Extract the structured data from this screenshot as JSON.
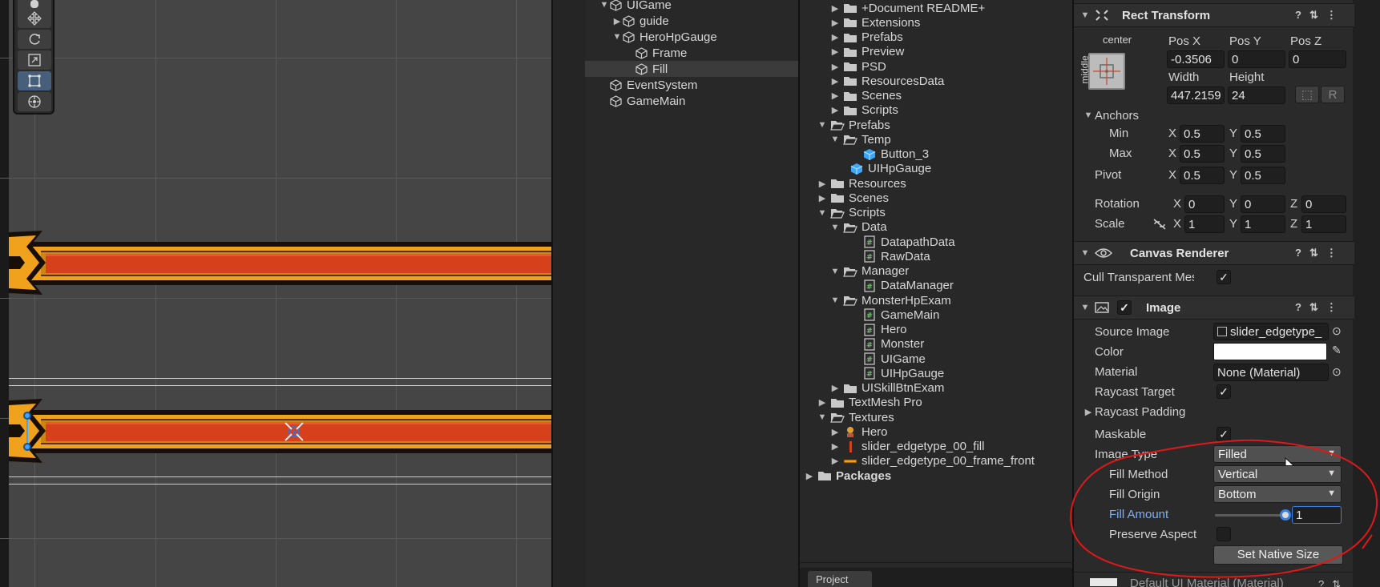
{
  "hierarchy": {
    "items": [
      {
        "label": "UIGame",
        "arrow": "down",
        "icon": "gameobject-icon"
      },
      {
        "label": "guide",
        "arrow": "right",
        "icon": "gameobject-icon"
      },
      {
        "label": "HeroHpGauge",
        "arrow": "down",
        "icon": "gameobject-icon"
      },
      {
        "label": "Frame",
        "arrow": "",
        "icon": "gameobject-icon"
      },
      {
        "label": "Fill",
        "arrow": "",
        "icon": "gameobject-icon",
        "selected": true
      },
      {
        "label": "EventSystem",
        "arrow": "",
        "icon": "gameobject-icon"
      },
      {
        "label": "GameMain",
        "arrow": "",
        "icon": "gameobject-icon"
      }
    ]
  },
  "project": {
    "items": [
      {
        "label": "+Document README+",
        "arrow": "right",
        "icon": "folder"
      },
      {
        "label": "Extensions",
        "arrow": "right",
        "icon": "folder"
      },
      {
        "label": "Prefabs",
        "arrow": "right",
        "icon": "folder"
      },
      {
        "label": "Preview",
        "arrow": "right",
        "icon": "folder"
      },
      {
        "label": "PSD",
        "arrow": "right",
        "icon": "folder"
      },
      {
        "label": "ResourcesData",
        "arrow": "right",
        "icon": "folder"
      },
      {
        "label": "Scenes",
        "arrow": "right",
        "icon": "folder"
      },
      {
        "label": "Scripts",
        "arrow": "right",
        "icon": "folder"
      },
      {
        "label": "Prefabs",
        "arrow": "down",
        "icon": "folder-open"
      },
      {
        "label": "Temp",
        "arrow": "down",
        "icon": "folder-open"
      },
      {
        "label": "Button_3",
        "arrow": "",
        "icon": "prefab"
      },
      {
        "label": "UIHpGauge",
        "arrow": "",
        "icon": "prefab"
      },
      {
        "label": "Resources",
        "arrow": "right",
        "icon": "folder"
      },
      {
        "label": "Scenes",
        "arrow": "right",
        "icon": "folder"
      },
      {
        "label": "Scripts",
        "arrow": "down",
        "icon": "folder-open"
      },
      {
        "label": "Data",
        "arrow": "down",
        "icon": "folder-open"
      },
      {
        "label": "DatapathData",
        "arrow": "",
        "icon": "script"
      },
      {
        "label": "RawData",
        "arrow": "",
        "icon": "script"
      },
      {
        "label": "Manager",
        "arrow": "down",
        "icon": "folder-open"
      },
      {
        "label": "DataManager",
        "arrow": "",
        "icon": "script"
      },
      {
        "label": "MonsterHpExam",
        "arrow": "down",
        "icon": "folder-open"
      },
      {
        "label": "GameMain",
        "arrow": "",
        "icon": "script"
      },
      {
        "label": "Hero",
        "arrow": "",
        "icon": "script"
      },
      {
        "label": "Monster",
        "arrow": "",
        "icon": "script"
      },
      {
        "label": "UIGame",
        "arrow": "",
        "icon": "script"
      },
      {
        "label": "UIHpGauge",
        "arrow": "",
        "icon": "script"
      },
      {
        "label": "UISkillBtnExam",
        "arrow": "right",
        "icon": "folder"
      },
      {
        "label": "TextMesh Pro",
        "arrow": "right",
        "icon": "folder"
      },
      {
        "label": "Textures",
        "arrow": "down",
        "icon": "folder-open"
      },
      {
        "label": "Hero",
        "arrow": "right",
        "icon": "sprite-hero"
      },
      {
        "label": "slider_edgetype_00_fill",
        "arrow": "right",
        "icon": "sprite-fill"
      },
      {
        "label": "slider_edgetype_00_frame_front",
        "arrow": "right",
        "icon": "sprite-frame"
      },
      {
        "label": "Packages",
        "arrow": "right",
        "icon": "folder",
        "bold": true
      }
    ],
    "tab_label": "Project"
  },
  "inspector": {
    "rect_transform": {
      "title": "Rect Transform",
      "anchor_h": "center",
      "anchor_v": "middle",
      "pos_x_label": "Pos X",
      "pos_y_label": "Pos Y",
      "pos_z_label": "Pos Z",
      "pos_x": "-0.3506",
      "pos_y": "0",
      "pos_z": "0",
      "width_label": "Width",
      "height_label": "Height",
      "width": "447.2159",
      "height": "24",
      "r_button": "R",
      "anchors_label": "Anchors",
      "min_label": "Min",
      "max_label": "Max",
      "pivot_label": "Pivot",
      "x_label": "X",
      "y_label": "Y",
      "z_label": "Z",
      "min_x": "0.5",
      "min_y": "0.5",
      "max_x": "0.5",
      "max_y": "0.5",
      "pivot_x": "0.5",
      "pivot_y": "0.5",
      "rotation_label": "Rotation",
      "rot_x": "0",
      "rot_y": "0",
      "rot_z": "0",
      "scale_label": "Scale",
      "scale_x": "1",
      "scale_y": "1",
      "scale_z": "1"
    },
    "canvas_renderer": {
      "title": "Canvas Renderer",
      "cull_label": "Cull Transparent Mes",
      "cull_checked": true
    },
    "image": {
      "title": "Image",
      "source_label": "Source Image",
      "source_value": "slider_edgetype_",
      "color_label": "Color",
      "color_value": "#ffffff",
      "material_label": "Material",
      "material_value": "None (Material)",
      "raycast_target_label": "Raycast Target",
      "raycast_padding_label": "Raycast Padding",
      "maskable_label": "Maskable",
      "image_type_label": "Image Type",
      "image_type_value": "Filled",
      "fill_method_label": "Fill Method",
      "fill_method_value": "Vertical",
      "fill_origin_label": "Fill Origin",
      "fill_origin_value": "Bottom",
      "fill_amount_label": "Fill Amount",
      "fill_amount_value": "1",
      "fill_amount_fraction": 1.0,
      "preserve_aspect_label": "Preserve Aspect",
      "set_native_size_label": "Set Native Size"
    },
    "next_component_label": "Default UI Material (Material)"
  },
  "colors": {
    "selection_accent": "#3b7fe0",
    "annotation": "#e01818",
    "fill_red": "#d6401a",
    "frame_orange": "#f1a21d"
  }
}
